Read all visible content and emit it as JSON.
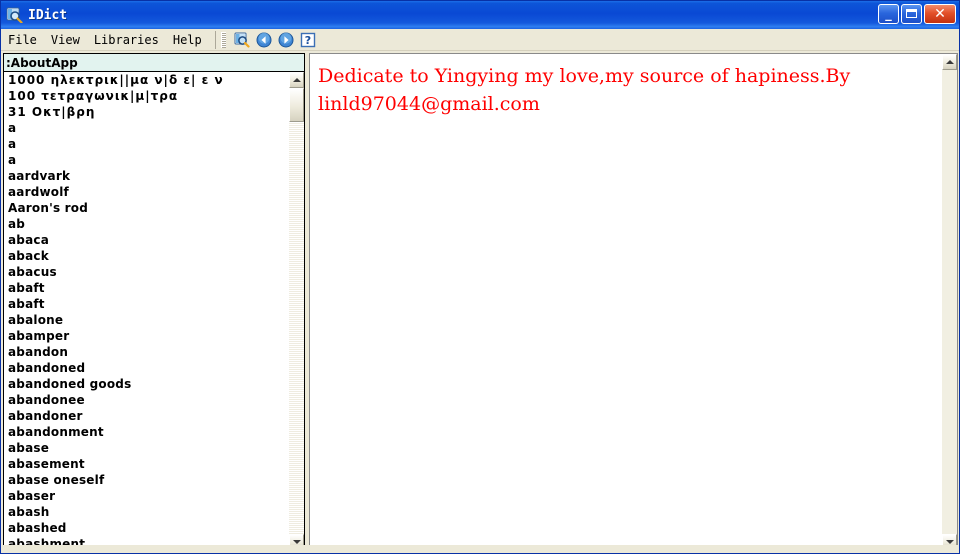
{
  "window": {
    "title": "IDict",
    "icon": "dictionary-search-icon",
    "controls": {
      "minimize_label": "_",
      "maximize_label": "",
      "close_label": "✕"
    },
    "accent_titlebar_color": "#0a49d4",
    "close_button_color": "#e3502a"
  },
  "menu": {
    "items": [
      {
        "label": "File"
      },
      {
        "label": "View"
      },
      {
        "label": "Libraries"
      },
      {
        "label": "Help"
      }
    ]
  },
  "toolbar": {
    "buttons": [
      {
        "icon": "search-book-icon",
        "label": ""
      },
      {
        "icon": "back-arrow-icon",
        "label": ""
      },
      {
        "icon": "forward-arrow-icon",
        "label": ""
      },
      {
        "icon": "help-question-icon",
        "label": "?"
      }
    ]
  },
  "search": {
    "value": ":AboutApp",
    "placeholder": ""
  },
  "word_list": {
    "items": [
      {
        "text": "1000 ηλεκτρικ||μα ν|δ ε| ε ν",
        "greek": true
      },
      {
        "text": "100 τετραγωνικ|μ|τρα",
        "greek": true
      },
      {
        "text": "31 Οκτ|βρη",
        "greek": true
      },
      {
        "text": "a",
        "greek": false
      },
      {
        "text": "a",
        "greek": false
      },
      {
        "text": "a",
        "greek": false
      },
      {
        "text": "aardvark",
        "greek": false
      },
      {
        "text": "aardwolf",
        "greek": false
      },
      {
        "text": "Aaron's rod",
        "greek": false
      },
      {
        "text": "ab",
        "greek": false
      },
      {
        "text": "abaca",
        "greek": false
      },
      {
        "text": "aback",
        "greek": false
      },
      {
        "text": "abacus",
        "greek": false
      },
      {
        "text": "abaft",
        "greek": false
      },
      {
        "text": "abaft",
        "greek": false
      },
      {
        "text": "abalone",
        "greek": false
      },
      {
        "text": "abamper",
        "greek": false
      },
      {
        "text": "abandon",
        "greek": false
      },
      {
        "text": "abandoned",
        "greek": false
      },
      {
        "text": "abandoned goods",
        "greek": false
      },
      {
        "text": "abandonee",
        "greek": false
      },
      {
        "text": "abandoner",
        "greek": false
      },
      {
        "text": "abandonment",
        "greek": false
      },
      {
        "text": "abase",
        "greek": false
      },
      {
        "text": "abasement",
        "greek": false
      },
      {
        "text": "abase oneself",
        "greek": false
      },
      {
        "text": "abaser",
        "greek": false
      },
      {
        "text": "abash",
        "greek": false
      },
      {
        "text": "abashed",
        "greek": false
      },
      {
        "text": "abashment",
        "greek": false
      }
    ]
  },
  "content": {
    "dedication_line1": "Dedicate to Yingying my love,my source of hapiness.By",
    "dedication_line2": "linld97044@gmail.com",
    "text_color": "#ff0000"
  }
}
